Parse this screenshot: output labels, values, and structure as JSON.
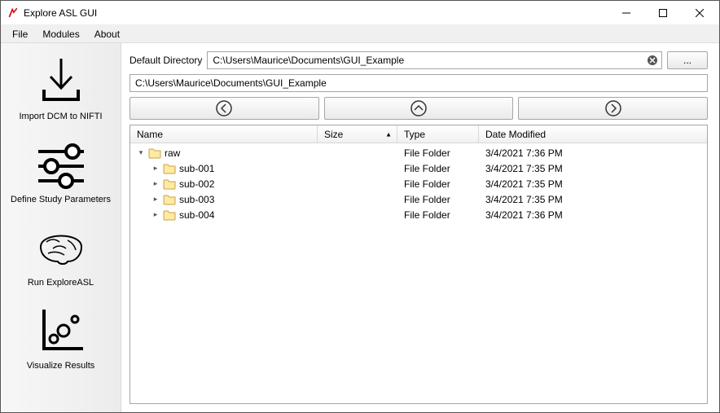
{
  "window": {
    "title": "Explore ASL GUI"
  },
  "menubar": {
    "file": "File",
    "modules": "Modules",
    "about": "About"
  },
  "sidebar": {
    "import": "Import DCM to NIFTI",
    "params": "Define Study Parameters",
    "run": "Run ExploreASL",
    "visualize": "Visualize Results"
  },
  "main": {
    "default_dir_label": "Default Directory",
    "default_dir_value": "C:\\Users\\Maurice\\Documents\\GUI_Example",
    "path_value": "C:\\Users\\Maurice\\Documents\\GUI_Example",
    "ellipsis": "..."
  },
  "explorer": {
    "cols": {
      "name": "Name",
      "size": "Size",
      "type": "Type",
      "date": "Date Modified"
    },
    "rows": [
      {
        "indent": 0,
        "exp": "down",
        "name": "raw",
        "type": "File Folder",
        "date": "3/4/2021 7:36 PM"
      },
      {
        "indent": 1,
        "exp": "right",
        "name": "sub-001",
        "type": "File Folder",
        "date": "3/4/2021 7:35 PM"
      },
      {
        "indent": 1,
        "exp": "right",
        "name": "sub-002",
        "type": "File Folder",
        "date": "3/4/2021 7:35 PM"
      },
      {
        "indent": 1,
        "exp": "right",
        "name": "sub-003",
        "type": "File Folder",
        "date": "3/4/2021 7:35 PM"
      },
      {
        "indent": 1,
        "exp": "right",
        "name": "sub-004",
        "type": "File Folder",
        "date": "3/4/2021 7:36 PM"
      }
    ]
  }
}
